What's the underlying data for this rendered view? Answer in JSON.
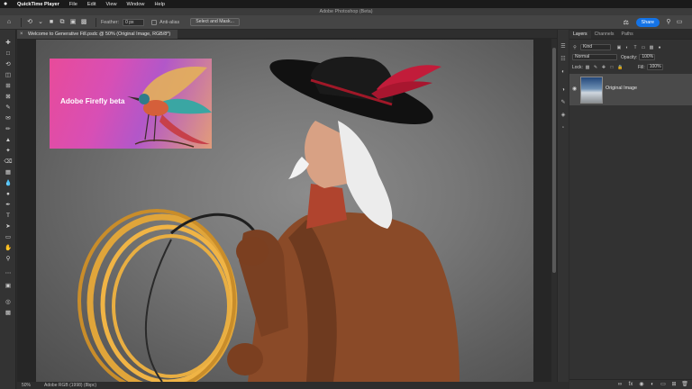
{
  "menubar": {
    "apple_icon": "apple-icon",
    "app_name": "QuickTime Player",
    "items": [
      "File",
      "Edit",
      "View",
      "Window",
      "Help"
    ]
  },
  "window": {
    "title": "Adobe Photoshop (Beta)"
  },
  "options_bar": {
    "feather_label": "Feather:",
    "feather_value": "0 px",
    "antialias_label": "Anti-alias",
    "select_mask_label": "Select and Mask...",
    "share_label": "Share"
  },
  "document": {
    "tab_title": "Welcome to Generative Fill.psdc @ 50% (Original Image, RGB/8*)",
    "firefly_card_title": "Adobe Firefly beta"
  },
  "status": {
    "zoom": "50%",
    "profile": "Adobe RGB (1998) (8bpc)"
  },
  "layers_panel": {
    "tabs": [
      "Layers",
      "Channels",
      "Paths"
    ],
    "kind_label": "Kind",
    "blend_mode": "Normal",
    "opacity_label": "Opacity:",
    "opacity_value": "100%",
    "lock_label": "Lock:",
    "fill_label": "Fill:",
    "fill_value": "100%",
    "layer_name": "Original Image"
  },
  "colors": {
    "accent": "#1473e6",
    "panel": "#323232",
    "toolbar": "#333333",
    "selected_layer": "#4a4a4a"
  }
}
